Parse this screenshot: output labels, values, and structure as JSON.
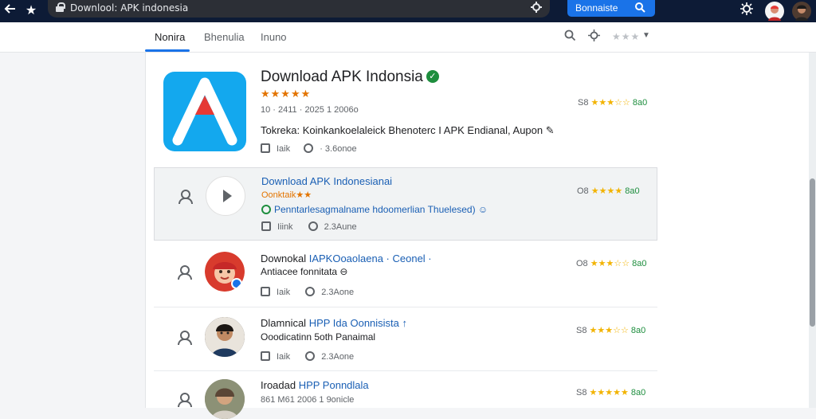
{
  "browser": {
    "url_text": "Downlool: APK indonesia",
    "search_button_label": "Bonnaiste",
    "icons": [
      "back-icon",
      "star-icon",
      "lock-icon",
      "extension-icon",
      "search-icon",
      "settings-icon",
      "avatar",
      "avatar"
    ]
  },
  "tabs": [
    {
      "label": "Nonira",
      "active": true
    },
    {
      "label": "Bhenulia",
      "active": false
    },
    {
      "label": "Inuno",
      "active": false
    }
  ],
  "hero": {
    "title": "Download APK Indonsia",
    "stars": "★★★★★",
    "meta": "10 · 2411 · 2025 1 2006o",
    "description": "Tokreka: Koinkankoelaleick Bhenoterc I APK Endianal, Aupon ✎",
    "foot_a": "Iaik",
    "foot_b": "· 3.6onoe",
    "rating_num": "S8",
    "rating_stars": "★★★☆☆",
    "rating_count": "8a0"
  },
  "results": [
    {
      "title": "Download APK Indonesianai",
      "title_blue": true,
      "subtitle": "Oonktaik★★",
      "line2": "Penntarlesagmalname hdoomerlian Thuelesed) ☺",
      "foot_a": "Iiink",
      "foot_b": "2.3Aune",
      "rating_num": "O8",
      "rating_stars": "★★★★",
      "rating_count": "8a0"
    },
    {
      "title": "Downokal ",
      "title_blue_part": "IAPKOoaolaena · Ceonel ·",
      "subtitle": "Antiacee fonnitata ⊖",
      "foot_a": "Iaik",
      "foot_b": "2.3Aone",
      "rating_num": "O8",
      "rating_stars": "★★★☆☆",
      "rating_count": "8a0"
    },
    {
      "title": "Dlamnical ",
      "title_blue_part": "HPP Ida Oonnisista ↑",
      "subtitle": "Ooodicatinn 5oth Panaimal",
      "foot_a": "Iaik",
      "foot_b": "2.3Aone",
      "rating_num": "S8",
      "rating_stars": "★★★☆☆",
      "rating_count": "8a0"
    },
    {
      "title": "Iroadad ",
      "title_blue_part": "HPP Ponndlala",
      "subtitle": "861 M61 2006 1 9onicle",
      "foot_a": "",
      "foot_b": "",
      "rating_num": "S8",
      "rating_stars": "★★★★★",
      "rating_count": "8a0"
    }
  ],
  "colors": {
    "topbar": "#0d1b36",
    "accent": "#1a73e8",
    "app_icon": "#13a8ee",
    "app_logo_red": "#e53935",
    "star": "#e37400",
    "verified": "#1e8e3e"
  }
}
